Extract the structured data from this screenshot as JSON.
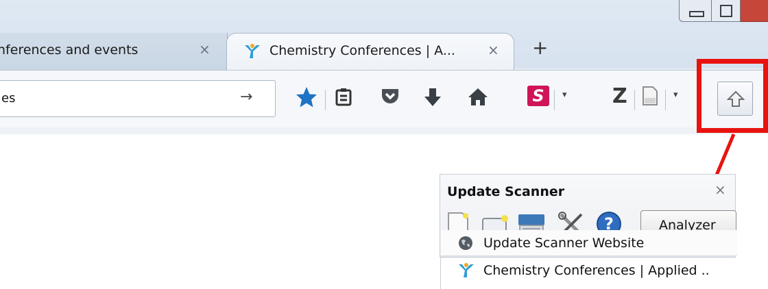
{
  "tabs": [
    {
      "label": "nferences and events",
      "close": "×"
    },
    {
      "label": "Chemistry Conferences | A...",
      "close": "×"
    }
  ],
  "new_tab_label": "+",
  "address_bar": {
    "value": "es",
    "go_glyph": "→"
  },
  "toolbar": {
    "icons": [
      "bookmark-star-icon",
      "reading-list-icon",
      "pocket-icon",
      "downloads-icon",
      "home-icon",
      "s-addon-icon",
      "zotero-icon",
      "page-icon",
      "update-scanner-icon"
    ],
    "s_label": "S",
    "z_label": "Z",
    "dropdown_glyph": "▾",
    "star_color": "#1f73c4"
  },
  "annotation": {
    "color": "#e8130f"
  },
  "update_scanner_panel": {
    "title": "Update Scanner",
    "close": "×",
    "icons": [
      "new-page-icon",
      "new-item-icon",
      "scan-icon",
      "settings-tools-icon",
      "help-icon"
    ],
    "analyze_button": "Analyzer",
    "items": [
      {
        "label": "Update Scanner Website",
        "icon": "globe-icon"
      },
      {
        "label": "Chemistry Conferences | Applied ..",
        "icon": "conference-favicon-icon"
      }
    ]
  }
}
